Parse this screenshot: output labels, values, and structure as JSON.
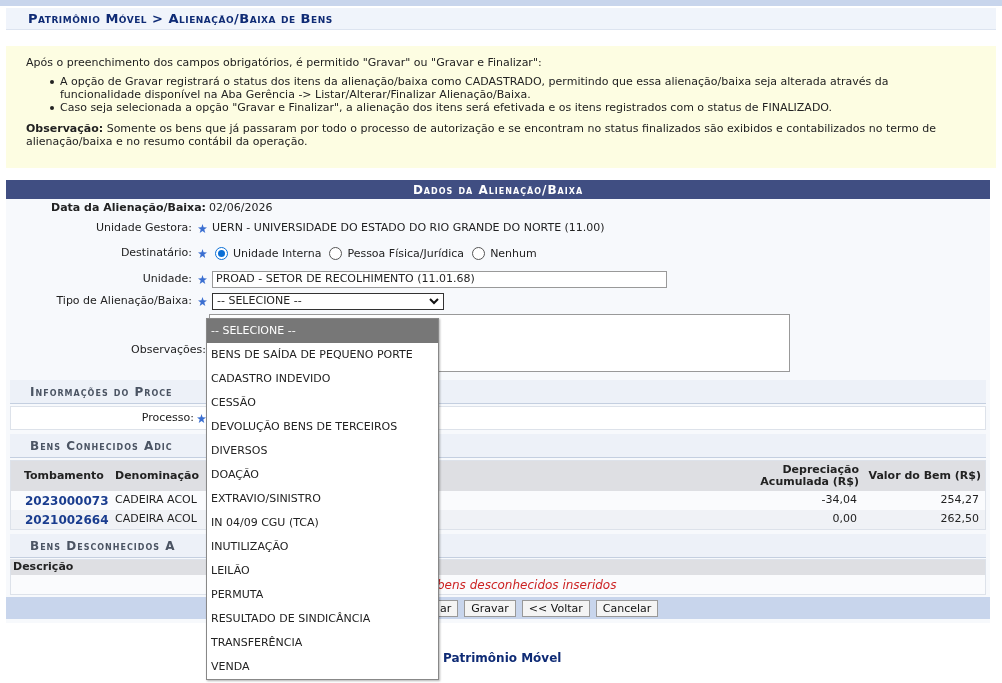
{
  "breadcrumb": "Patrimônio Móvel > Alienação/Baixa de Bens",
  "info": {
    "intro": "Após o preenchimento dos campos obrigatórios, é permitido \"Gravar\" ou \"Gravar e Finalizar\":",
    "bullets": [
      "A opção de Gravar registrará o status dos itens da alienação/baixa como CADASTRADO, permitindo que essa alienação/baixa seja alterada através da funcionalidade disponível na Aba Gerência -> Listar/Alterar/Finalizar Alienação/Baixa.",
      "Caso seja selecionada a opção \"Gravar e Finalizar\", a alienação dos itens será efetivada e os itens registrados com o status de FINALIZADO."
    ],
    "note": "**Observação:** Somente os bens que já passaram por todo o processo de autorização e se encontram no status finalizados são exibidos e contabilizados no termo de alienação/baixa e no resumo contábil da operação."
  },
  "form": {
    "title": "Dados da Alienação/Baixa",
    "date_label": "Data da Alienação/Baixa:",
    "date_value": "02/06/2026",
    "unidade_gestora_label": "Unidade Gestora:",
    "unidade_gestora_value": "UERN - UNIVERSIDADE DO ESTADO DO RIO GRANDE DO NORTE (11.00)",
    "destinatario_label": "Destinatário:",
    "destinatario_options": [
      {
        "label": "Unidade Interna",
        "selected": true
      },
      {
        "label": "Pessoa Física/Jurídica",
        "selected": false
      },
      {
        "label": "Nenhum",
        "selected": false
      }
    ],
    "unidade_label": "Unidade:",
    "unidade_value": "PROAD - SETOR DE RECOLHIMENTO (11.01.68)",
    "tipo_label": "Tipo de Alienação/Baixa:",
    "tipo_value": "-- SELECIONE --",
    "tipo_expanded": true,
    "tipo_options": [
      {
        "label": "-- SELECIONE --",
        "selected": true
      },
      {
        "label": "BENS DE SAÍDA DE PEQUENO PORTE",
        "selected": false
      },
      {
        "label": "CADASTRO INDEVIDO",
        "selected": false
      },
      {
        "label": "CESSÃO",
        "selected": false
      },
      {
        "label": "DEVOLUÇÃO BENS DE TERCEIROS",
        "selected": false
      },
      {
        "label": "DIVERSOS",
        "selected": false
      },
      {
        "label": "DOAÇÃO",
        "selected": false
      },
      {
        "label": "EXTRAVIO/SINISTRO",
        "selected": false
      },
      {
        "label": "IN 04/09 CGU (TCA)",
        "selected": false
      },
      {
        "label": "INUTILIZAÇÃO",
        "selected": false
      },
      {
        "label": "LEILÃO",
        "selected": false
      },
      {
        "label": "PERMUTA",
        "selected": false
      },
      {
        "label": "RESULTADO DE SINDICÂNCIA",
        "selected": false
      },
      {
        "label": "TRANSFERÊNCIA",
        "selected": false
      },
      {
        "label": "VENDA",
        "selected": false
      }
    ],
    "observacoes_label": "Observações:"
  },
  "processo_section": {
    "title": "Informações do Proce",
    "processo_label": "Processo:"
  },
  "bens_conhecidos": {
    "title": "Bens Conhecidos Adic",
    "columns": [
      "Tombamento",
      "Denominação",
      "Depreciação Acumulada (R$)",
      "Valor do Bem (R$)"
    ],
    "rows": [
      [
        "2023000073",
        "CADEIRA ACOL",
        "-34,04",
        "254,27"
      ],
      [
        "2021002664",
        "CADEIRA ACOL",
        "0,00",
        "262,50"
      ]
    ]
  },
  "bens_desconhecidos": {
    "title": "Bens Desconhecidos A",
    "columns": [
      "Descrição"
    ],
    "empty_message": "bens desconhecidos inseridos"
  },
  "buttons": [
    "ar",
    "Gravar",
    "<< Voltar",
    "Cancelar"
  ],
  "footer_link": "Patrimônio Móvel"
}
